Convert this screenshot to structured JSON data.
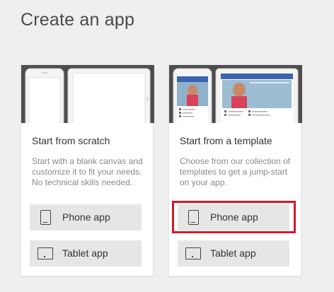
{
  "page": {
    "title": "Create an app"
  },
  "cards": [
    {
      "title": "Start from scratch",
      "description": "Start with a blank canvas and customize it to fit your needs. No technical skills needed.",
      "buttons": [
        {
          "label": "Phone app",
          "icon": "phone-icon"
        },
        {
          "label": "Tablet app",
          "icon": "tablet-icon"
        }
      ]
    },
    {
      "title": "Start from a template",
      "description": "Choose from our collection of templates to get a jump-start on your app.",
      "buttons": [
        {
          "label": "Phone app",
          "icon": "phone-icon",
          "highlighted": true
        },
        {
          "label": "Tablet app",
          "icon": "tablet-icon"
        }
      ]
    }
  ],
  "colors": {
    "background": "#efefef",
    "card": "#ffffff",
    "preview_dark": "#4d4d4d",
    "button": "#e6e6e6",
    "highlight": "#d11a2a",
    "template_header_blue": "#3b63b4"
  }
}
